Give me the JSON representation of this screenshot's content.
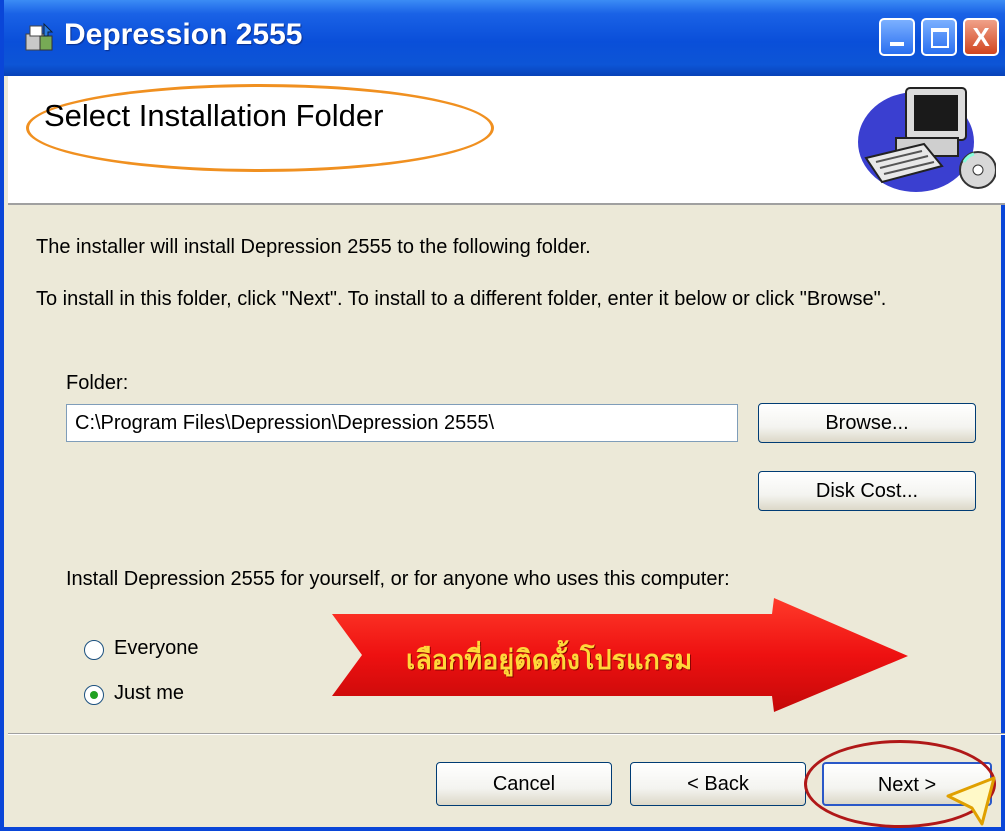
{
  "window": {
    "title": "Depression 2555",
    "controls": {
      "close_glyph": "X"
    }
  },
  "banner": {
    "title": "Select Installation Folder",
    "icon": "computer-illustration"
  },
  "body": {
    "intro_line": "The installer will install Depression 2555 to the following folder.",
    "instruction_line": "To install in this folder, click \"Next\". To install to a different folder, enter it below or click \"Browse\".",
    "folder_label": "Folder:",
    "folder_value": "C:\\Program Files\\Depression\\Depression 2555\\",
    "browse_label": "Browse...",
    "disk_cost_label": "Disk Cost...",
    "scope_prompt": "Install Depression 2555 for yourself, or for anyone who uses this computer:",
    "options": [
      {
        "label": "Everyone",
        "selected": false
      },
      {
        "label": "Just me",
        "selected": true
      }
    ]
  },
  "annotation": {
    "arrow_text": "เลือกที่อยู่ติดตั้งโปรแกรม",
    "arrow_color": "#ee1111",
    "text_color": "#ffd83a",
    "highlight_color": "#b01818"
  },
  "footer": {
    "cancel_label": "Cancel",
    "back_label": "< Back",
    "next_label": "Next >"
  },
  "colors": {
    "titlebar": "#0a4fd9",
    "dialog_bg": "#ece9d8",
    "banner_oval": "#f09020"
  }
}
